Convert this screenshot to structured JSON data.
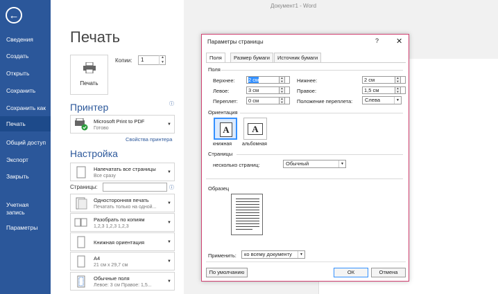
{
  "window_title": "Документ1 - Word",
  "sidebar": {
    "items": [
      "Сведения",
      "Создать",
      "Открыть",
      "Сохранить",
      "Сохранить как",
      "Печать",
      "Общий доступ",
      "Экспорт",
      "Закрыть"
    ],
    "account": "Учетная запись",
    "params": "Параметры",
    "active_index": 5
  },
  "print": {
    "title": "Печать",
    "print_button": "Печать",
    "copies_label": "Копии:",
    "copies_value": "1"
  },
  "printer": {
    "heading": "Принтер",
    "name": "Microsoft Print to PDF",
    "status": "Готово",
    "properties_link": "Свойства принтера"
  },
  "settings": {
    "heading": "Настройка",
    "pages_label": "Страницы:",
    "items": [
      {
        "l1": "Напечатать все страницы",
        "l2": "Все сразу"
      },
      {
        "l1": "Односторонняя печать",
        "l2": "Печатать только на одной..."
      },
      {
        "l1": "Разобрать по копиям",
        "l2": "1,2,3    1,2,3    1,2,3"
      },
      {
        "l1": "Книжная ориентация",
        "l2": ""
      },
      {
        "l1": "A4",
        "l2": "21 см x 29,7 см"
      },
      {
        "l1": "Обычные поля",
        "l2": "Левое:  3 см    Правое:  1,5..."
      }
    ]
  },
  "dialog": {
    "title": "Параметры страницы",
    "help": "?",
    "close": "✕",
    "tabs": [
      "Поля",
      "Размер бумаги",
      "Источник бумаги"
    ],
    "margins_group": "Поля",
    "fields": {
      "top_label": "Верхнее:",
      "top_value": "2 см",
      "bottom_label": "Нижнее:",
      "bottom_value": "2 см",
      "left_label": "Левое:",
      "left_value": "3 см",
      "right_label": "Правое:",
      "right_value": "1,5 см",
      "gutter_label": "Переплет:",
      "gutter_value": "0 см",
      "gutter_pos_label": "Положение переплета:",
      "gutter_pos_value": "Слева"
    },
    "orientation_group": "Ориентация",
    "portrait": "книжная",
    "landscape": "альбомная",
    "pages_group": "Страницы",
    "multiple_pages_label": "несколько страниц:",
    "multiple_pages_value": "Обычный",
    "sample_group": "Образец",
    "apply_label": "Применить:",
    "apply_value": "ко всему документу",
    "default_button": "По умолчанию",
    "ok_button": "ОК",
    "cancel_button": "Отмена"
  }
}
